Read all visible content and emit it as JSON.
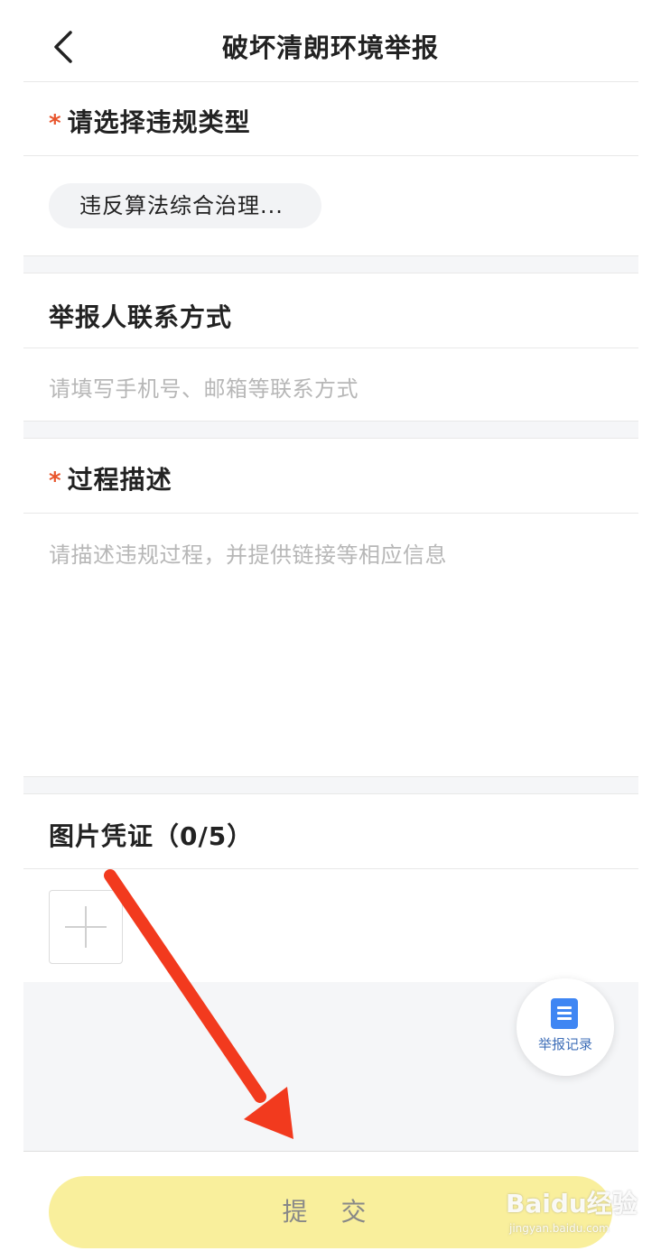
{
  "header": {
    "title": "破坏清朗环境举报",
    "back_icon": "back-arrow-icon"
  },
  "violation_type": {
    "title": "请选择违规类型",
    "required_mark": "*",
    "selected_chip": "违反算法综合治理..."
  },
  "contact": {
    "title": "举报人联系方式",
    "placeholder": "请填写手机号、邮箱等联系方式"
  },
  "description": {
    "title": "过程描述",
    "required_mark": "*",
    "placeholder": "请描述违规过程，并提供链接等相应信息"
  },
  "evidence": {
    "title": "图片凭证（0/5）",
    "add_icon": "plus-icon"
  },
  "fab": {
    "label": "举报记录",
    "icon": "document-icon"
  },
  "submit": {
    "label": "提 交"
  },
  "watermark": {
    "logo": "Baidu经验",
    "sub": "jingyan.baidu.com"
  },
  "colors": {
    "required": "#e8542b",
    "submit_bg": "#f9ef9c",
    "fab_icon": "#3f86f3",
    "annotation_arrow": "#f23a1e"
  }
}
